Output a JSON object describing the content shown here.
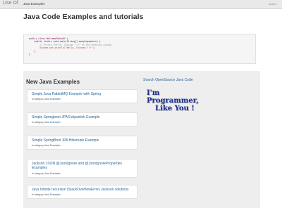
{
  "topbar": {
    "brand": "Use Of",
    "nav_item": "Java Examples",
    "right_text": "search"
  },
  "page_title": "Java Code Examples and tutorials",
  "code": {
    "line1": "public class WelcomeToUseOf {",
    "line2": "    public static void main(String[] manyArguments) {",
    "line3": "        // Prints \"Hello, Chinese !!!\" to the terminal window.",
    "line4": "        System.out.println(\"Hello, Chinese !!!\");",
    "line5": "    }",
    "line6": "}"
  },
  "panel": {
    "title": "New Java Examples",
    "category_prefix": "In category",
    "cards": [
      {
        "title": "Simple Java RabbitMQ Example with Spring",
        "category": "Java Examples"
      },
      {
        "title": "Simple Springboot JPA Eclipselink Example",
        "category": "Java Examples"
      },
      {
        "title": "Simple SpringBoot JPA Hibernate Example",
        "category": "Java Examples"
      },
      {
        "title": "Jackson JSON @JsonIgnore and @JsonIgnoreProperties Examples",
        "category": "Java Examples"
      },
      {
        "title": "Java Infinite recursion (StackOverflowError) Jackson solutions",
        "category": "Java Examples"
      }
    ]
  },
  "sidebar": {
    "search_link": "Search OpenSource Java Code",
    "logo_line1": "I'm Programmer,",
    "logo_line2": "Like You !"
  },
  "colors": {
    "link": "#2a6496",
    "logo": "#1a2a8a",
    "panel_bg": "#eeeeee"
  }
}
